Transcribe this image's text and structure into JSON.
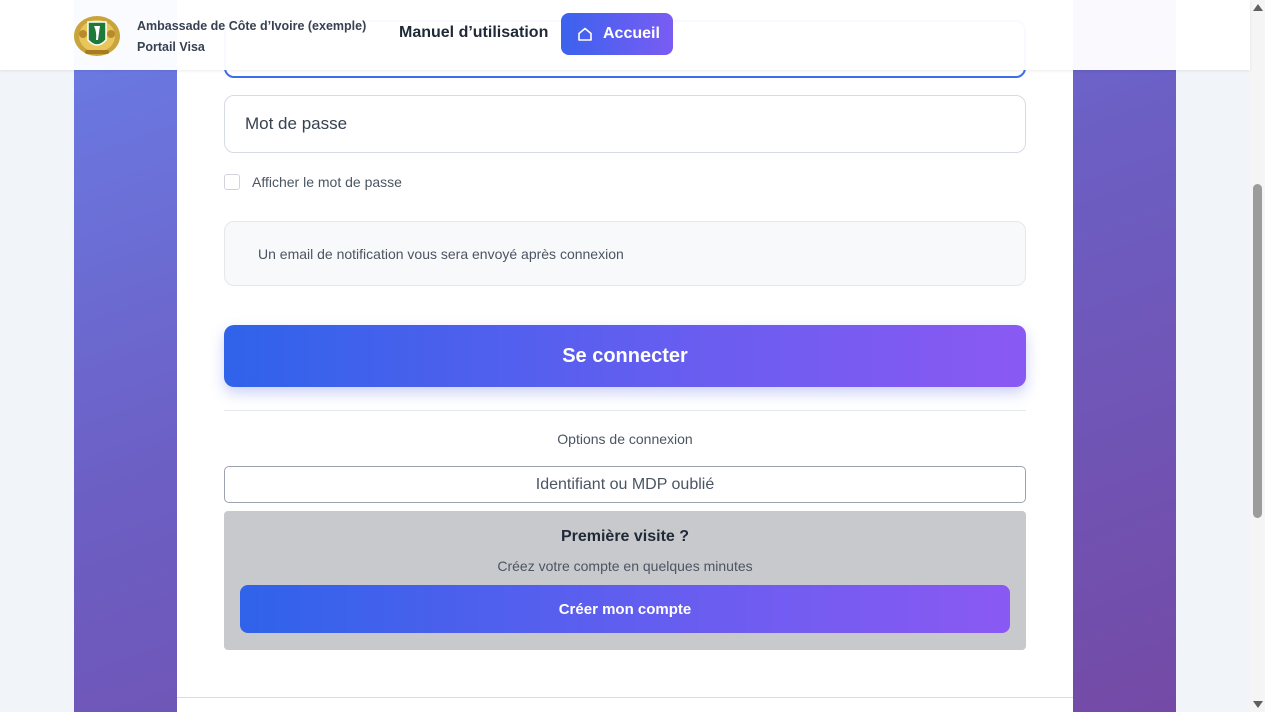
{
  "header": {
    "brand_line1": "Ambassade de Côte d’Ivoire (exemple)",
    "brand_line2": "Portail Visa",
    "nav_manual": "Manuel d’utilisation",
    "nav_home": "Accueil",
    "logo_icon": "coat-of-arms-icon",
    "home_icon": "home-icon"
  },
  "form": {
    "password_placeholder": "Mot de passe",
    "show_password_label": "Afficher le mot de passe",
    "notice_text": "Un email de notification vous sera envoyé après connexion",
    "login_button": "Se connecter",
    "options_label": "Options de connexion",
    "forgot_button": "Identifiant ou MDP oublié"
  },
  "first_visit": {
    "title": "Première visite ?",
    "subtitle": "Créez votre compte en quelques minutes",
    "create_button": "Créer mon compte"
  },
  "colors": {
    "accent_start": "#2f63ea",
    "accent_end": "#8a59f3",
    "background_band": "#6c5fc4"
  }
}
